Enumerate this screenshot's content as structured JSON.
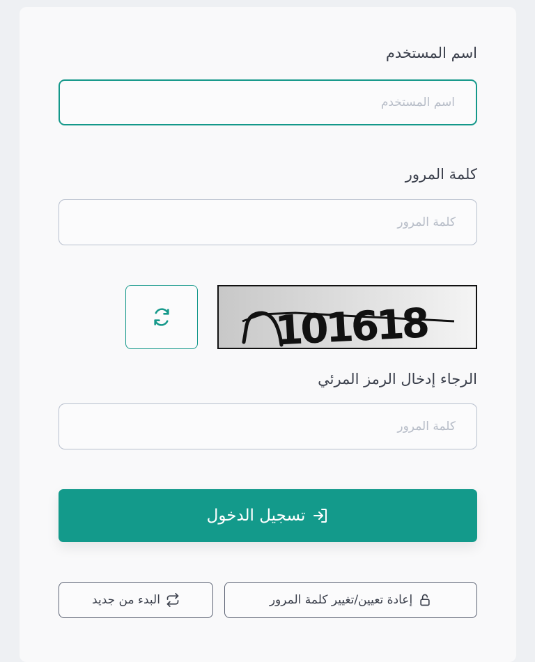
{
  "form": {
    "username": {
      "label": "اسم المستخدم",
      "placeholder": "اسم المستخدم"
    },
    "password": {
      "label": "كلمة المرور",
      "placeholder": "كلمة المرور"
    },
    "captcha": {
      "image_text": "101618",
      "label": "الرجاء إدخال الرمز المرئي",
      "placeholder": "كلمة المرور",
      "refresh_icon": "refresh-icon"
    },
    "submit": {
      "label": "تسجيل الدخول",
      "icon": "sign-in-icon"
    },
    "reset_password": {
      "label": "إعادة تعيين/تغيير كلمة المرور",
      "icon": "lock-icon"
    },
    "restart": {
      "label": "البدء من جديد",
      "icon": "repeat-icon"
    }
  },
  "colors": {
    "accent": "#139a8b",
    "border": "#b7bfcd",
    "text": "#3a3f4b"
  }
}
